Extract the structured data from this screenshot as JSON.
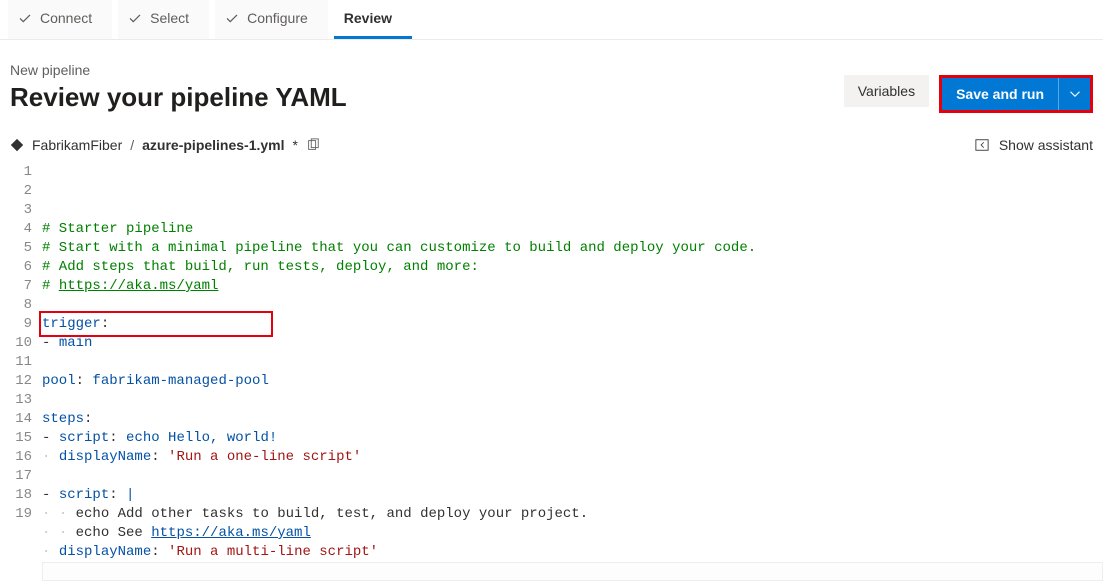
{
  "wizard": {
    "tabs": [
      {
        "label": "Connect",
        "complete": true,
        "active": false
      },
      {
        "label": "Select",
        "complete": true,
        "active": false
      },
      {
        "label": "Configure",
        "complete": true,
        "active": false
      },
      {
        "label": "Review",
        "complete": false,
        "active": true
      }
    ]
  },
  "header": {
    "subtitle": "New pipeline",
    "title": "Review your pipeline YAML",
    "variables_label": "Variables",
    "save_run_label": "Save and run"
  },
  "breadcrumb": {
    "project": "FabrikamFiber",
    "separator": "/",
    "file": "azure-pipelines-1.yml",
    "dirty_marker": "*"
  },
  "assistant": {
    "label": "Show assistant"
  },
  "editor": {
    "lines": [
      {
        "n": 1,
        "type": "comment",
        "text": "# Starter pipeline"
      },
      {
        "n": 2,
        "type": "comment",
        "text": "# Start with a minimal pipeline that you can customize to build and deploy your code."
      },
      {
        "n": 3,
        "type": "comment",
        "text": "# Add steps that build, run tests, deploy, and more:"
      },
      {
        "n": 4,
        "type": "commentlink",
        "prefix": "# ",
        "link": "https://aka.ms/yaml"
      },
      {
        "n": 5,
        "type": "blank",
        "text": ""
      },
      {
        "n": 6,
        "type": "key",
        "key": "trigger",
        "suffix": ":"
      },
      {
        "n": 7,
        "type": "listval",
        "text": "- main"
      },
      {
        "n": 8,
        "type": "blank",
        "text": ""
      },
      {
        "n": 9,
        "type": "kv",
        "key": "pool",
        "value": "fabrikam-managed-pool"
      },
      {
        "n": 10,
        "type": "blank",
        "text": ""
      },
      {
        "n": 11,
        "type": "key",
        "key": "steps",
        "suffix": ":"
      },
      {
        "n": 12,
        "type": "kv_dash",
        "key": "script",
        "value": "echo Hello, world!"
      },
      {
        "n": 13,
        "type": "kv_indent_str",
        "key": "displayName",
        "value": "'Run a one-line script'"
      },
      {
        "n": 14,
        "type": "blank",
        "text": ""
      },
      {
        "n": 15,
        "type": "kv_dash",
        "key": "script",
        "value": "|"
      },
      {
        "n": 16,
        "type": "indent2",
        "text": "echo Add other tasks to build, test, and deploy your project."
      },
      {
        "n": 17,
        "type": "indent2link",
        "prefix": "echo See ",
        "link": "https://aka.ms/yaml"
      },
      {
        "n": 18,
        "type": "kv_indent_str",
        "key": "displayName",
        "value": "'Run a multi-line script'"
      },
      {
        "n": 19,
        "type": "blank_current",
        "text": ""
      }
    ]
  }
}
